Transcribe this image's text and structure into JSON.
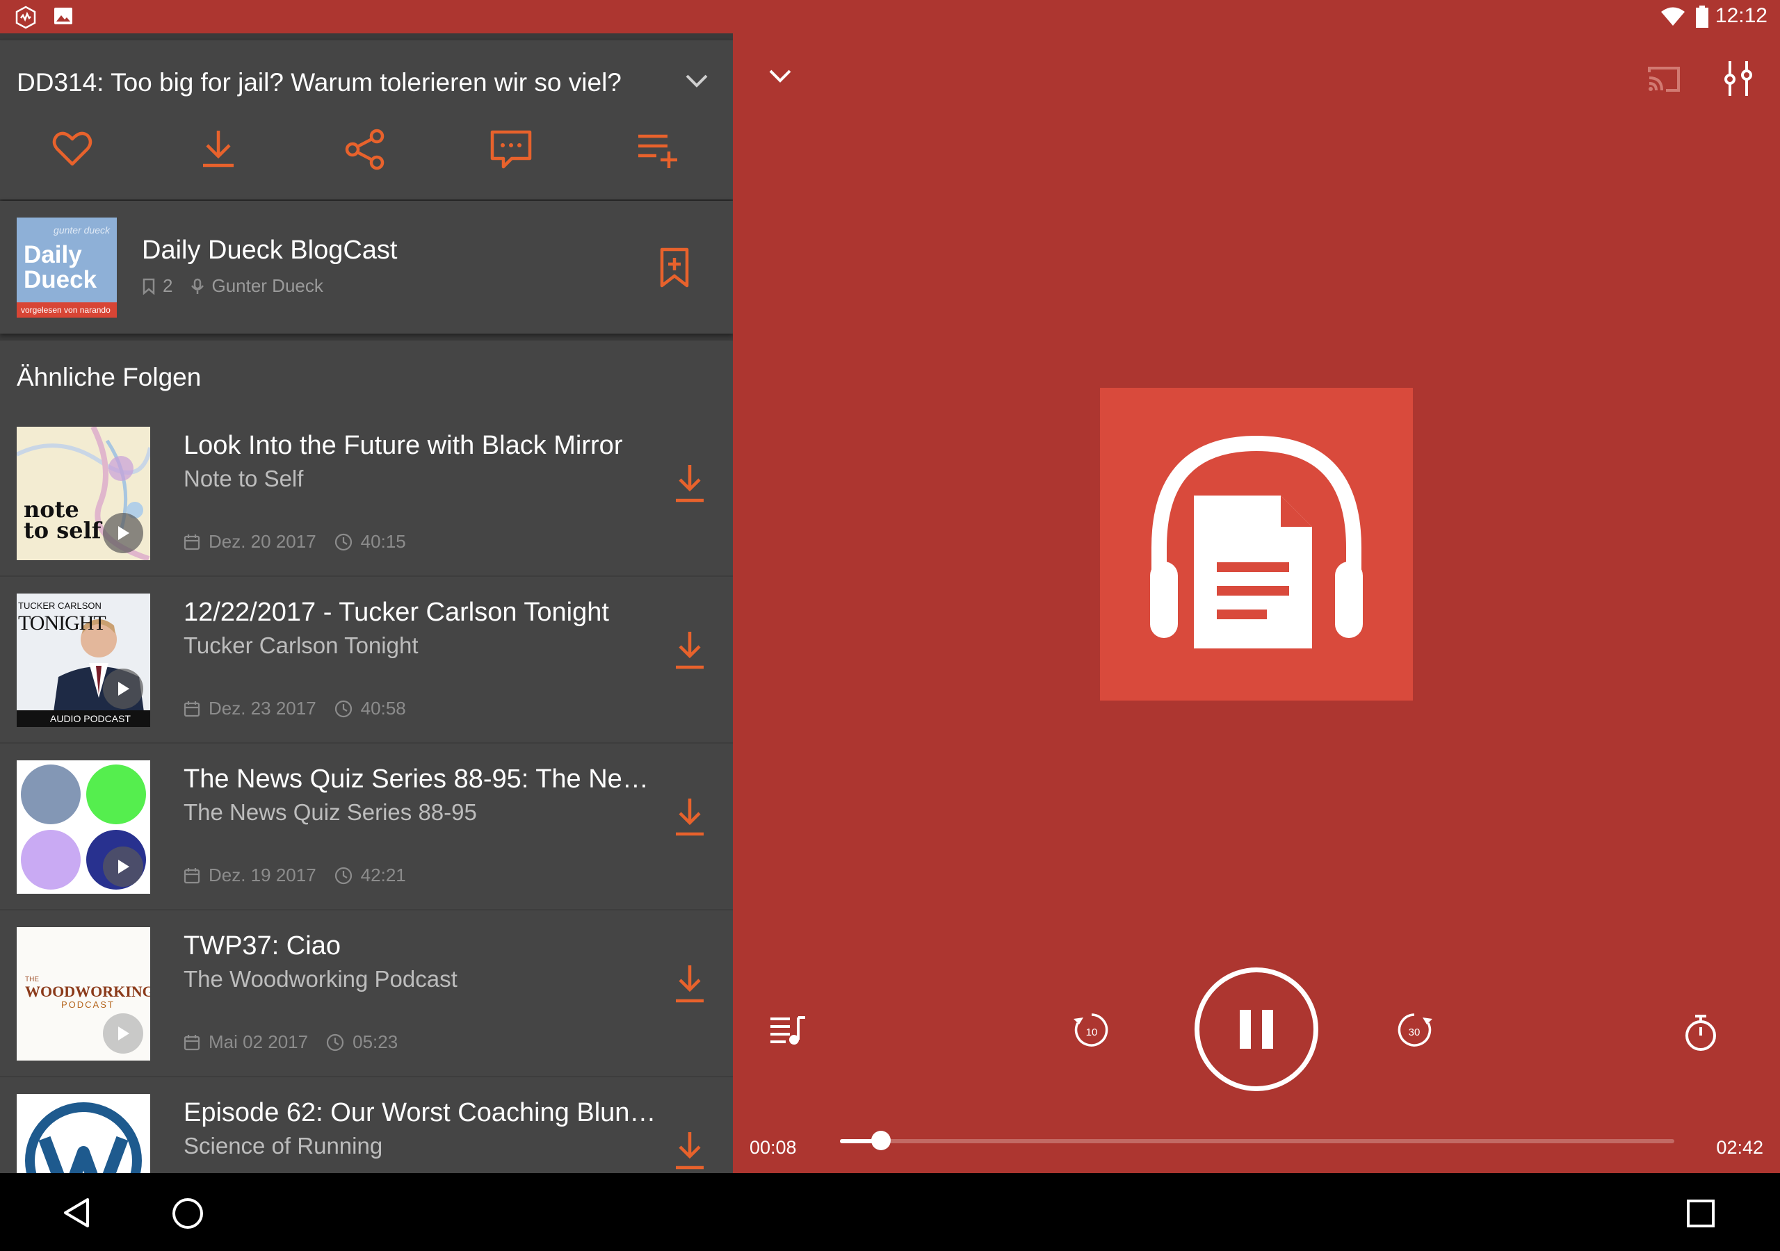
{
  "status_bar": {
    "time": "12:12",
    "icons": [
      "app-icon",
      "image-icon",
      "wifi-icon",
      "battery-icon"
    ]
  },
  "episode": {
    "title": "DD314: Too big for jail? Warum tolerieren wir so viel?",
    "actions": [
      "heart-icon",
      "download-icon",
      "share-icon",
      "comment-icon",
      "add-to-playlist-icon"
    ]
  },
  "podcast": {
    "name": "Daily Dueck BlogCast",
    "bookmarks": "2",
    "author": "Gunter Dueck",
    "cover": {
      "top": "gunter dueck",
      "title": "Daily Dueck",
      "bottom": "vorgelesen von narando"
    }
  },
  "similar": {
    "heading": "Ähnliche Folgen",
    "items": [
      {
        "title": "Look Into the Future with Black Mirror",
        "podcast": "Note to Self",
        "date": "Dez. 20 2017",
        "duration": "40:15"
      },
      {
        "title": "12/22/2017 - Tucker Carlson Tonight",
        "podcast": "Tucker Carlson Tonight",
        "date": "Dez. 23 2017",
        "duration": "40:58"
      },
      {
        "title": "The News Quiz Series 88-95: The New…",
        "podcast": "The News Quiz Series 88-95",
        "date": "Dez. 19 2017",
        "duration": "42:21"
      },
      {
        "title": "TWP37: Ciao",
        "podcast": "The Woodworking Podcast",
        "date": "Mai 02 2017",
        "duration": "05:23"
      },
      {
        "title": "Episode 62: Our Worst Coaching Blun…",
        "podcast": "Science of Running",
        "date": "",
        "duration": ""
      }
    ],
    "thumb_text": {
      "note_to_self": "note to self",
      "tucker_top": "TUCKER CARLSON",
      "tucker_big": "TONIGHT",
      "tucker_bottom": "AUDIO PODCAST",
      "wood_small": "THE",
      "wood_big": "WOODWORKING",
      "wood_sub": "PODCAST"
    }
  },
  "player": {
    "current_time": "00:08",
    "total_time": "02:42",
    "progress": 0.049,
    "rewind_seconds": "10",
    "forward_seconds": "30",
    "state": "playing"
  },
  "colors": {
    "accent": "#e8622c",
    "player_bg": "#ad3630",
    "card_bg": "#454545",
    "art_bg": "#d94a3c"
  }
}
